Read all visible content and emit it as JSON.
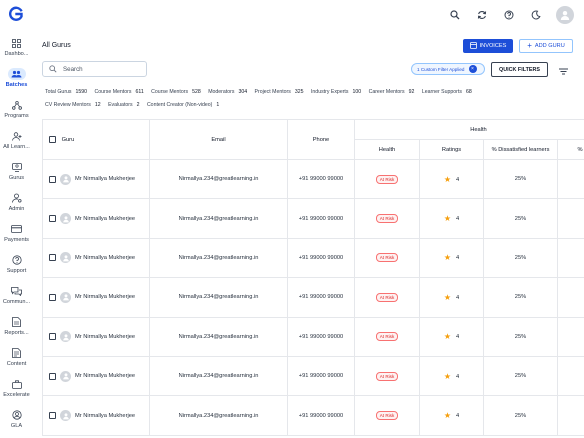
{
  "topbar": {
    "logo": "G"
  },
  "sidebar": {
    "items": [
      {
        "label": "Dashbo...",
        "icon": "dashboard-icon",
        "active": false
      },
      {
        "label": "Batches",
        "icon": "batches-icon",
        "active": true
      },
      {
        "label": "Programs",
        "icon": "programs-icon",
        "active": false
      },
      {
        "label": "All Learn...",
        "icon": "learners-icon",
        "active": false
      },
      {
        "label": "Gurus",
        "icon": "gurus-icon",
        "active": false
      },
      {
        "label": "Admin",
        "icon": "admin-icon",
        "active": false
      },
      {
        "label": "Payments",
        "icon": "payments-icon",
        "active": false
      },
      {
        "label": "Support",
        "icon": "support-icon",
        "active": false
      },
      {
        "label": "Commun...",
        "icon": "community-icon",
        "active": false
      },
      {
        "label": "Reports...",
        "icon": "reports-icon",
        "active": false
      },
      {
        "label": "Content",
        "icon": "content-icon",
        "active": false
      },
      {
        "label": "Excelerate",
        "icon": "excelerate-icon",
        "active": false
      },
      {
        "label": "GLA",
        "icon": "gla-icon",
        "active": false
      }
    ]
  },
  "main": {
    "title": "All Gurus",
    "invoices_label": "INVOICES",
    "add_guru_label": "ADD GURU",
    "search_placeholder": "Search",
    "filter_chip": "1 Custom Filter Applied",
    "quick_filters_label": "QUICK FILTERS"
  },
  "stats": [
    {
      "label": "Total Gurus",
      "value": "1590"
    },
    {
      "label": "Course Mentors",
      "value": "611"
    },
    {
      "label": "Course Mentors",
      "value": "528"
    },
    {
      "label": "Moderators",
      "value": "304"
    },
    {
      "label": "Project Mentors",
      "value": "325"
    },
    {
      "label": "Industry Experts",
      "value": "100"
    },
    {
      "label": "Career Mentors",
      "value": "92"
    },
    {
      "label": "Learner Supports",
      "value": "68"
    },
    {
      "label": "CV Review Mentors",
      "value": "12"
    },
    {
      "label": "Evaluators",
      "value": "2"
    },
    {
      "label": "Content Creator (Non-video)",
      "value": "1"
    }
  ],
  "table": {
    "headers": {
      "guru": "Guru",
      "email": "Email",
      "phone": "Phone",
      "health_group": "Health",
      "health": "Health",
      "ratings": "Ratings",
      "dissatisfied": "% Dissatisfied learners",
      "extra": "%"
    },
    "rows": [
      {
        "name": "Mr Nirmallya Mukherjee",
        "email": "Nirmallya.234@greatlearning.in",
        "phone": "+91 99000 99000",
        "health": "At Risk",
        "rating": "4",
        "dissatisfied": "25%"
      },
      {
        "name": "Mr Nirmallya Mukherjee",
        "email": "Nirmallya.234@greatlearning.in",
        "phone": "+91 99000 99000",
        "health": "At Risk",
        "rating": "4",
        "dissatisfied": "25%"
      },
      {
        "name": "Mr Nirmallya Mukherjee",
        "email": "Nirmallya.234@greatlearning.in",
        "phone": "+91 99000 99000",
        "health": "At Risk",
        "rating": "4",
        "dissatisfied": "25%"
      },
      {
        "name": "Mr Nirmallya Mukherjee",
        "email": "Nirmallya.234@greatlearning.in",
        "phone": "+91 99000 99000",
        "health": "At Risk",
        "rating": "4",
        "dissatisfied": "25%"
      },
      {
        "name": "Mr Nirmallya Mukherjee",
        "email": "Nirmallya.234@greatlearning.in",
        "phone": "+91 99000 99000",
        "health": "At Risk",
        "rating": "4",
        "dissatisfied": "25%"
      },
      {
        "name": "Mr Nirmallya Mukherjee",
        "email": "Nirmallya.234@greatlearning.in",
        "phone": "+91 99000 99000",
        "health": "At Risk",
        "rating": "4",
        "dissatisfied": "25%"
      },
      {
        "name": "Mr Nirmallya Mukherjee",
        "email": "Nirmallya.234@greatlearning.in",
        "phone": "+91 99000 99000",
        "health": "At Risk",
        "rating": "4",
        "dissatisfied": "25%"
      }
    ]
  },
  "colors": {
    "primary": "#1d4ed8",
    "risk": "#dc2626",
    "star": "#f59e0b"
  }
}
